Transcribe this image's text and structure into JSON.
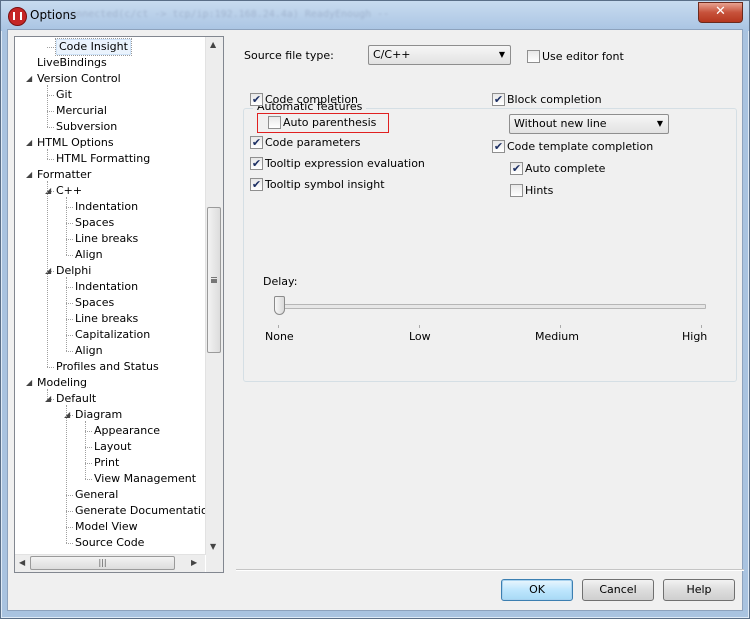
{
  "window": {
    "title": "Options",
    "blurred_text": "-- connected(c/ct -> tcp/ip:192.168.24.4a) ReadyEnough --"
  },
  "tree": {
    "items": [
      {
        "label": "Code Insight",
        "level": 1,
        "selected": true
      },
      {
        "label": "LiveBindings",
        "level": 0
      },
      {
        "label": "Version Control",
        "level": 0,
        "expanded": true
      },
      {
        "label": "Git",
        "level": 1
      },
      {
        "label": "Mercurial",
        "level": 1
      },
      {
        "label": "Subversion",
        "level": 1
      },
      {
        "label": "HTML Options",
        "level": 0,
        "expanded": true
      },
      {
        "label": "HTML Formatting",
        "level": 1
      },
      {
        "label": "Formatter",
        "level": 0,
        "expanded": true
      },
      {
        "label": "C++",
        "level": 1,
        "expanded": true
      },
      {
        "label": "Indentation",
        "level": 2
      },
      {
        "label": "Spaces",
        "level": 2
      },
      {
        "label": "Line breaks",
        "level": 2
      },
      {
        "label": "Align",
        "level": 2
      },
      {
        "label": "Delphi",
        "level": 1,
        "expanded": true
      },
      {
        "label": "Indentation",
        "level": 2
      },
      {
        "label": "Spaces",
        "level": 2
      },
      {
        "label": "Line breaks",
        "level": 2
      },
      {
        "label": "Capitalization",
        "level": 2
      },
      {
        "label": "Align",
        "level": 2
      },
      {
        "label": "Profiles and Status",
        "level": 1
      },
      {
        "label": "Modeling",
        "level": 0,
        "expanded": true
      },
      {
        "label": "Default",
        "level": 1,
        "expanded": true
      },
      {
        "label": "Diagram",
        "level": 2,
        "expanded": true
      },
      {
        "label": "Appearance",
        "level": 3
      },
      {
        "label": "Layout",
        "level": 3
      },
      {
        "label": "Print",
        "level": 3
      },
      {
        "label": "View Management",
        "level": 3
      },
      {
        "label": "General",
        "level": 2
      },
      {
        "label": "Generate Documentation",
        "level": 2
      },
      {
        "label": "Model View",
        "level": 2
      },
      {
        "label": "Source Code",
        "level": 2
      }
    ]
  },
  "source_file_type": {
    "label": "Source file type:",
    "value": "C/C++"
  },
  "use_editor_font": {
    "label": "Use editor font",
    "checked": false
  },
  "automatic_features": {
    "title": "Automatic features",
    "code_completion": {
      "label": "Code completion",
      "checked": true
    },
    "auto_parenthesis": {
      "label": "Auto parenthesis",
      "checked": false
    },
    "code_parameters": {
      "label": "Code parameters",
      "checked": true
    },
    "tooltip_expression": {
      "label": "Tooltip expression evaluation",
      "checked": true
    },
    "tooltip_symbol": {
      "label": "Tooltip symbol insight",
      "checked": true
    },
    "block_completion": {
      "label": "Block completion",
      "checked": true
    },
    "block_completion_mode": {
      "value": "Without new line"
    },
    "code_template": {
      "label": "Code template completion",
      "checked": true
    },
    "auto_complete": {
      "label": "Auto complete",
      "checked": true
    },
    "hints": {
      "label": "Hints",
      "checked": false
    }
  },
  "delay": {
    "label": "Delay:",
    "value": "None",
    "ticks": [
      "None",
      "Low",
      "Medium",
      "High"
    ]
  },
  "buttons": {
    "ok": "OK",
    "cancel": "Cancel",
    "help": "Help"
  },
  "icons": {
    "close": "close-icon",
    "app": "app-icon",
    "check": "checkmark-icon",
    "combo": "chevron-down-icon"
  },
  "check_glyph": "✔"
}
